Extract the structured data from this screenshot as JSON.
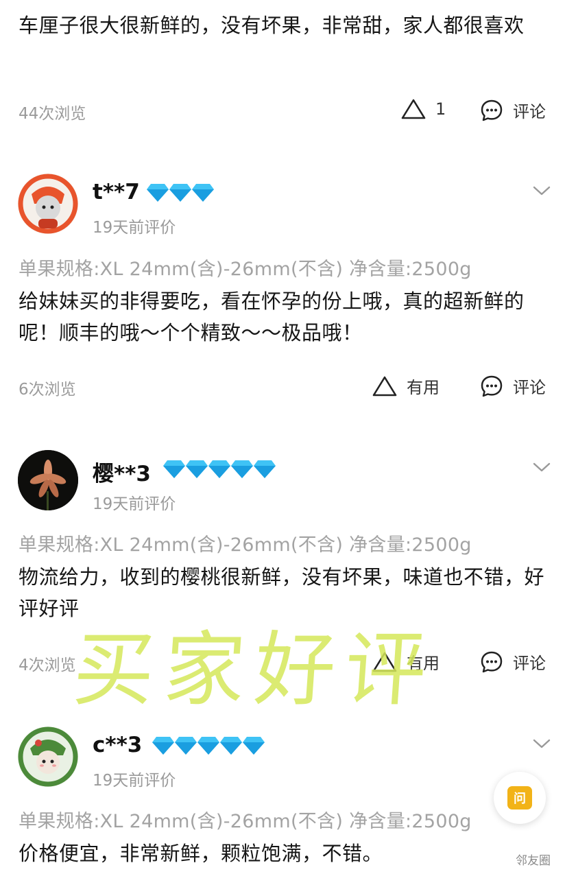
{
  "reviews": [
    {
      "text": "车厘子很大很新鲜的，没有坏果，非常甜，家人都很喜欢",
      "views": "44次浏览",
      "useful": "1",
      "comment": "评论"
    },
    {
      "username": "t**7",
      "diamond_count": 3,
      "date": "19天前评价",
      "spec": "单果规格:XL 24mm(含)-26mm(不含) 净含量:2500g",
      "text": "给妹妹买的非得要吃，看在怀孕的份上哦，真的超新鲜的呢！顺丰的哦～个个精致～～极品哦！",
      "views": "6次浏览",
      "useful": "有用",
      "comment": "评论"
    },
    {
      "username": "樱**3",
      "diamond_count": 5,
      "date": "19天前评价",
      "spec": "单果规格:XL 24mm(含)-26mm(不含) 净含量:2500g",
      "text": "物流给力，收到的樱桃很新鲜，没有坏果，味道也不错，好评好评",
      "views": "4次浏览",
      "useful": "有用",
      "comment": "评论"
    },
    {
      "username": "c**3",
      "diamond_count": 5,
      "date": "19天前评价",
      "spec": "单果规格:XL 24mm(含)-26mm(不含) 净含量:2500g",
      "text": "价格便宜，非常新鲜，颗粒饱满，不错。"
    }
  ],
  "watermark": "买家好评",
  "float_button": "问",
  "corner_mark": "邻友圈",
  "colors": {
    "diamond": "#3fc3f5",
    "watermark": "#d5e85a",
    "float": "#f2b318"
  }
}
